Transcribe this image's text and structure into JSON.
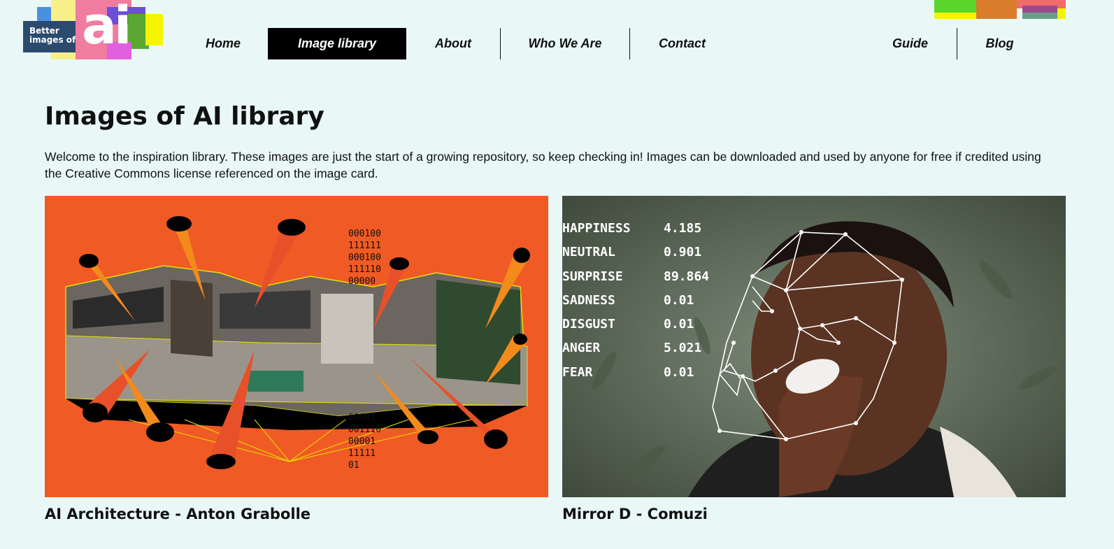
{
  "logo": {
    "line1": "Better",
    "line2": "images of",
    "ai": "ai"
  },
  "nav": {
    "main": [
      {
        "label": "Home"
      },
      {
        "label": "Image library",
        "active": true
      },
      {
        "label": "About"
      },
      {
        "label": "Who We Are"
      },
      {
        "label": "Contact"
      }
    ],
    "side": [
      {
        "label": "Guide"
      },
      {
        "label": "Blog"
      }
    ]
  },
  "page": {
    "title": "Images of AI library",
    "intro": "Welcome to the inspiration library. These images are just the start of a growing repository, so keep checking in! Images can be downloaded and used by anyone for free if credited using the Creative Commons license referenced on the image card."
  },
  "cards": [
    {
      "caption": "AI Architecture - Anton Grabolle",
      "binary_block_top": [
        "000100",
        "111111",
        "000100",
        "111110",
        "00000"
      ],
      "binary_block_bottom": [
        "00001",
        "001110",
        "00001",
        "11111",
        "01"
      ]
    },
    {
      "caption": "Mirror D - Comuzi",
      "emotions": [
        {
          "label": "HAPPINESS",
          "value": "4.185"
        },
        {
          "label": "NEUTRAL",
          "value": "0.901"
        },
        {
          "label": "SURPRISE",
          "value": "89.864"
        },
        {
          "label": "SADNESS",
          "value": "0.01"
        },
        {
          "label": "DISGUST",
          "value": "0.01"
        },
        {
          "label": "ANGER",
          "value": "5.021"
        },
        {
          "label": "FEAR",
          "value": "0.01"
        }
      ]
    }
  ],
  "colors": {
    "background": "#e9f8f6",
    "nav_active": "#000000",
    "card1_bg": "#f05a24"
  }
}
